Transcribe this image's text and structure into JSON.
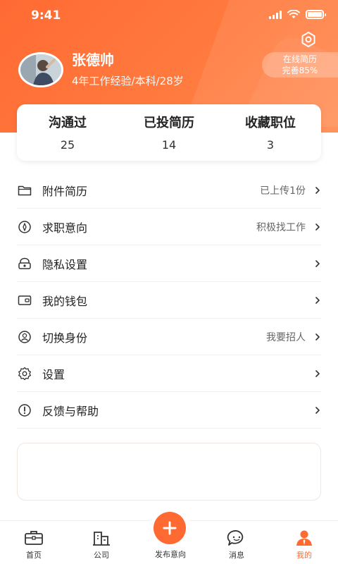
{
  "status_bar": {
    "time": "9:41"
  },
  "profile": {
    "name": "张德帅",
    "subtitle": "4年工作经验/本科/28岁"
  },
  "resume_badge": {
    "line1": "在线简历",
    "line2": "完善85%",
    "completion_percent": 85
  },
  "stats": [
    {
      "label": "沟通过",
      "value": "25"
    },
    {
      "label": "已投简历",
      "value": "14"
    },
    {
      "label": "收藏职位",
      "value": "3"
    }
  ],
  "menu": [
    {
      "label": "附件简历",
      "value": "已上传1份",
      "icon": "folder-icon"
    },
    {
      "label": "求职意向",
      "value": "积极找工作",
      "icon": "compass-icon"
    },
    {
      "label": "隐私设置",
      "value": "",
      "icon": "privacy-icon"
    },
    {
      "label": "我的钱包",
      "value": "",
      "icon": "wallet-icon"
    },
    {
      "label": "切换身份",
      "value": "我要招人",
      "icon": "user-switch-icon"
    },
    {
      "label": "设置",
      "value": "",
      "icon": "gear-icon"
    },
    {
      "label": "反馈与帮助",
      "value": "",
      "icon": "help-icon"
    }
  ],
  "tabbar": {
    "home": "首页",
    "company": "公司",
    "publish": "发布意向",
    "messages": "消息",
    "mine": "我的"
  },
  "colors": {
    "accent": "#ff6a33",
    "text": "#222222",
    "muted": "#666666"
  }
}
